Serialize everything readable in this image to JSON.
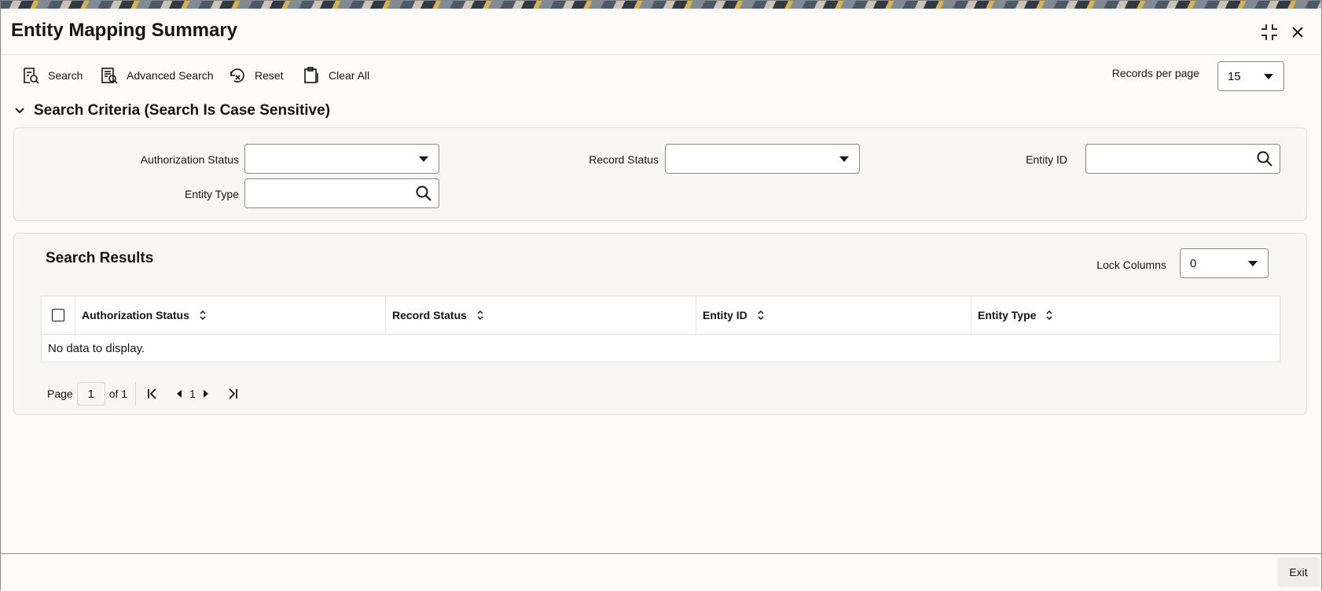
{
  "window": {
    "title": "Entity Mapping Summary"
  },
  "toolbar": {
    "search_label": "Search",
    "advanced_search_label": "Advanced Search",
    "reset_label": "Reset",
    "clear_all_label": "Clear All",
    "records_per_page_label": "Records per page",
    "records_per_page_value": "15"
  },
  "criteria": {
    "heading": "Search Criteria (Search Is Case Sensitive)",
    "authorization_status_label": "Authorization Status",
    "authorization_status_value": "",
    "record_status_label": "Record Status",
    "record_status_value": "",
    "entity_id_label": "Entity ID",
    "entity_id_value": "",
    "entity_type_label": "Entity Type",
    "entity_type_value": ""
  },
  "results": {
    "heading": "Search Results",
    "lock_columns_label": "Lock Columns",
    "lock_columns_value": "0",
    "columns": [
      "Authorization Status",
      "Record Status",
      "Entity ID",
      "Entity Type"
    ],
    "empty_message": "No data to display.",
    "pager": {
      "page_label": "Page",
      "current_page": "1",
      "of_label": "of 1",
      "nav_page": "1"
    }
  },
  "footer": {
    "exit_label": "Exit"
  },
  "colors": {
    "text": "#161513",
    "border": "#8b8985",
    "panel_bg": "#f7f6f4",
    "page_bg": "#fcfbfa"
  }
}
